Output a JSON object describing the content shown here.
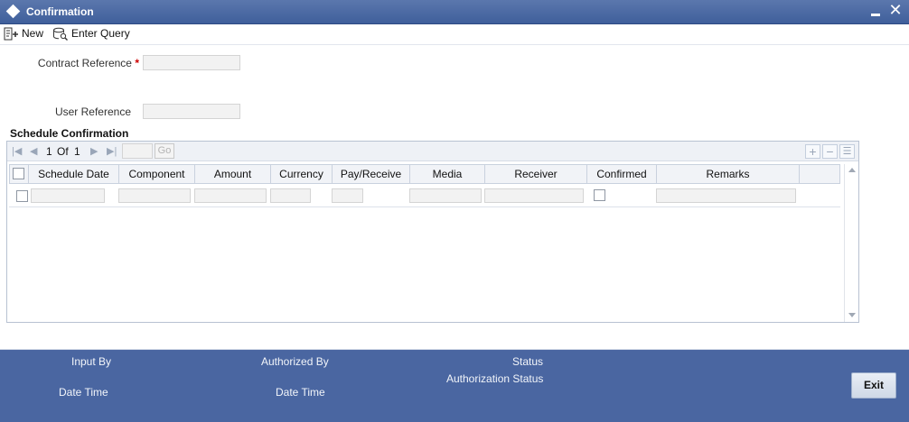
{
  "window": {
    "title": "Confirmation"
  },
  "toolbar": {
    "new_label": "New",
    "enter_query_label": "Enter Query"
  },
  "form": {
    "contract_reference_label": "Contract Reference",
    "required_marker": "*",
    "user_reference_label": "User Reference"
  },
  "schedule": {
    "section_title": "Schedule Confirmation",
    "pager": {
      "current": "1",
      "of_label": "Of",
      "total": "1",
      "go_label": "Go"
    },
    "add_label": "+",
    "remove_label": "−",
    "columns": [
      "Schedule Date",
      "Component",
      "Amount",
      "Currency",
      "Pay/Receive",
      "Media",
      "Receiver",
      "Confirmed",
      "Remarks"
    ]
  },
  "footer": {
    "input_by_label": "Input By",
    "authorized_by_label": "Authorized By",
    "status_label": "Status",
    "date_time_label_1": "Date Time",
    "date_time_label_2": "Date Time",
    "authorization_status_label": "Authorization Status",
    "exit_label": "Exit"
  },
  "colors": {
    "title_bar": "#4a66a1",
    "footer": "#4a66a1",
    "required": "#cc0000"
  }
}
